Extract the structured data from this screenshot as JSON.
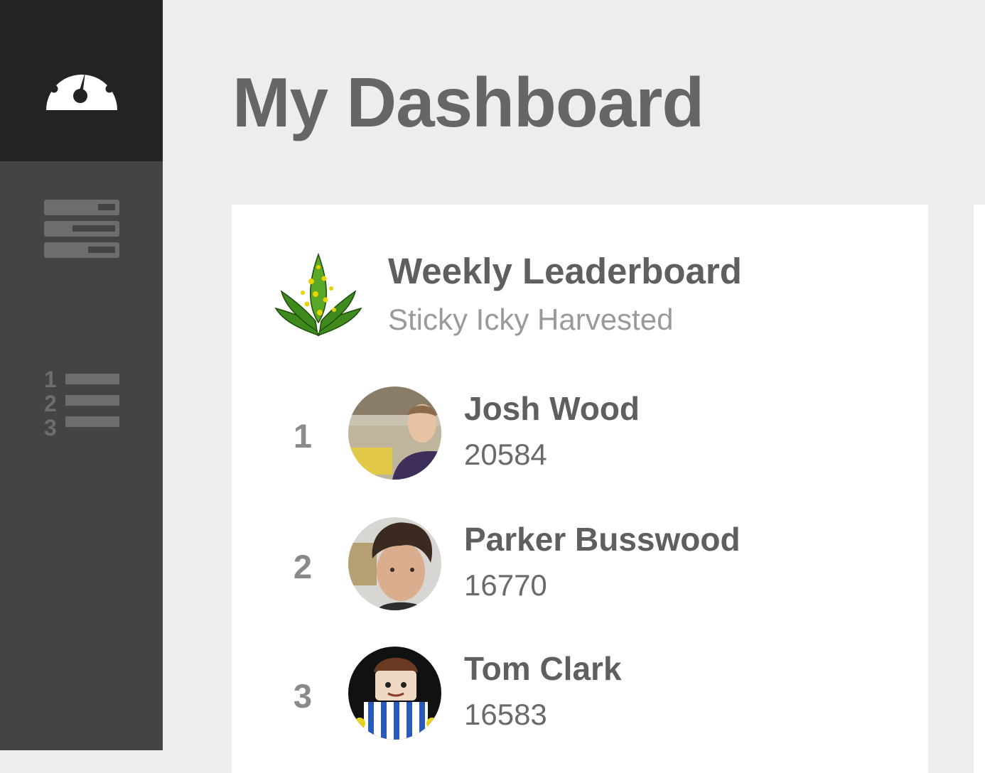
{
  "sidebar": {
    "items": [
      {
        "icon": "dashboard-gauge-icon",
        "active": true
      },
      {
        "icon": "layout-rows-icon",
        "active": false
      },
      {
        "icon": "ranked-list-icon",
        "active": false
      }
    ]
  },
  "header": {
    "title": "My Dashboard"
  },
  "leaderboard": {
    "icon": "cannabis-plant-icon",
    "title": "Weekly Leaderboard",
    "subtitle": "Sticky Icky Harvested",
    "entries": [
      {
        "rank": "1",
        "name": "Josh Wood",
        "score": "20584"
      },
      {
        "rank": "2",
        "name": "Parker Busswood",
        "score": "16770"
      },
      {
        "rank": "3",
        "name": "Tom Clark",
        "score": "16583"
      }
    ]
  },
  "colors": {
    "sidebar": "#444444",
    "sidebar_active": "#232323",
    "page_bg": "#ededed",
    "card_bg": "#ffffff",
    "title_text": "#666666"
  }
}
